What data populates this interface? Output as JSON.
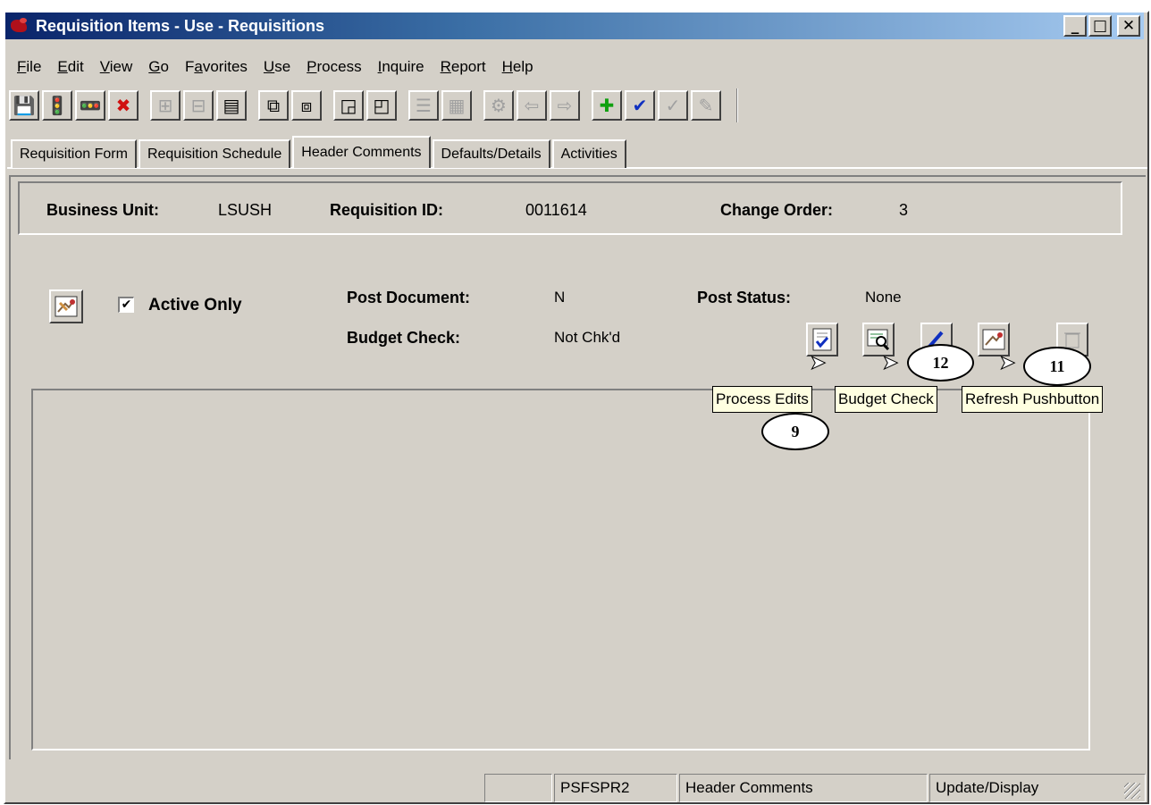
{
  "window": {
    "title": "Requisition Items - Use - Requisitions",
    "minimize": "_",
    "maximize": "□",
    "close": "✕"
  },
  "menu": [
    {
      "pre": "",
      "ul": "F",
      "post": "ile"
    },
    {
      "pre": "",
      "ul": "E",
      "post": "dit"
    },
    {
      "pre": "",
      "ul": "V",
      "post": "iew"
    },
    {
      "pre": "",
      "ul": "G",
      "post": "o"
    },
    {
      "pre": "F",
      "ul": "a",
      "post": "vorites"
    },
    {
      "pre": "",
      "ul": "U",
      "post": "se"
    },
    {
      "pre": "",
      "ul": "P",
      "post": "rocess"
    },
    {
      "pre": "",
      "ul": "I",
      "post": "nquire"
    },
    {
      "pre": "",
      "ul": "R",
      "post": "eport"
    },
    {
      "pre": "",
      "ul": "H",
      "post": "elp"
    }
  ],
  "toolbar": [
    {
      "icon": "save-icon",
      "glyph": "💾",
      "disabled": false,
      "gap": false
    },
    {
      "icon": "traffic-light-icon",
      "glyph": "🚦",
      "disabled": false,
      "gap": false
    },
    {
      "icon": "traffic-light-alert-icon",
      "glyph": "🚥",
      "disabled": false,
      "gap": false
    },
    {
      "icon": "cancel-icon",
      "glyph": "✖",
      "disabled": false,
      "gap": true
    },
    {
      "icon": "insert-row-icon",
      "glyph": "⊞",
      "disabled": true,
      "gap": false
    },
    {
      "icon": "delete-row-icon",
      "glyph": "⊟",
      "disabled": true,
      "gap": false
    },
    {
      "icon": "view-all-icon",
      "glyph": "▤",
      "disabled": false,
      "gap": true
    },
    {
      "icon": "next-page-icon",
      "glyph": "⧉",
      "disabled": false,
      "gap": false
    },
    {
      "icon": "previous-page-icon",
      "glyph": "⧈",
      "disabled": false,
      "gap": true
    },
    {
      "icon": "next-in-list-icon",
      "glyph": "◲",
      "disabled": false,
      "gap": false
    },
    {
      "icon": "previous-in-list-icon",
      "glyph": "◰",
      "disabled": false,
      "gap": true
    },
    {
      "icon": "list-icon",
      "glyph": "☰",
      "disabled": true,
      "gap": false
    },
    {
      "icon": "grid-icon",
      "glyph": "▦",
      "disabled": true,
      "gap": true
    },
    {
      "icon": "gear-icon",
      "glyph": "⚙",
      "disabled": true,
      "gap": false
    },
    {
      "icon": "back-arrow-icon",
      "glyph": "⇦",
      "disabled": true,
      "gap": false
    },
    {
      "icon": "forward-arrow-icon",
      "glyph": "⇨",
      "disabled": true,
      "gap": true
    },
    {
      "icon": "add-icon",
      "glyph": "✚",
      "disabled": false,
      "gap": false
    },
    {
      "icon": "checkmark-icon",
      "glyph": "✔",
      "disabled": false,
      "gap": false
    },
    {
      "icon": "check-plus-icon",
      "glyph": "✓",
      "disabled": true,
      "gap": false
    },
    {
      "icon": "pencil-icon",
      "glyph": "✎",
      "disabled": true,
      "gap": false
    }
  ],
  "tabs": [
    {
      "label": "Requisition Form",
      "active": false
    },
    {
      "label": "Requisition Schedule",
      "active": false
    },
    {
      "label": "Header Comments",
      "active": true
    },
    {
      "label": "Defaults/Details",
      "active": false
    },
    {
      "label": "Activities",
      "active": false
    }
  ],
  "header": {
    "business_unit_label": "Business Unit:",
    "business_unit": "LSUSH",
    "requisition_id_label": "Requisition ID:",
    "requisition_id": "0011614",
    "change_order_label": "Change Order:",
    "change_order": "3"
  },
  "body": {
    "active_only_label": "Active Only",
    "active_only_checked": "✔",
    "post_document_label": "Post Document:",
    "post_document": "N",
    "post_status_label": "Post Status:",
    "post_status": "None",
    "budget_check_label": "Budget Check:",
    "budget_check": "Not Chk'd"
  },
  "tooltips": {
    "process_edits": "Process Edits",
    "budget_check": "Budget Check",
    "refresh": "Refresh Pushbutton"
  },
  "callouts": {
    "nine": "9",
    "twelve": "12",
    "eleven": "11"
  },
  "status": {
    "server": "PSFSPR2",
    "page": "Header Comments",
    "mode": "Update/Display"
  }
}
